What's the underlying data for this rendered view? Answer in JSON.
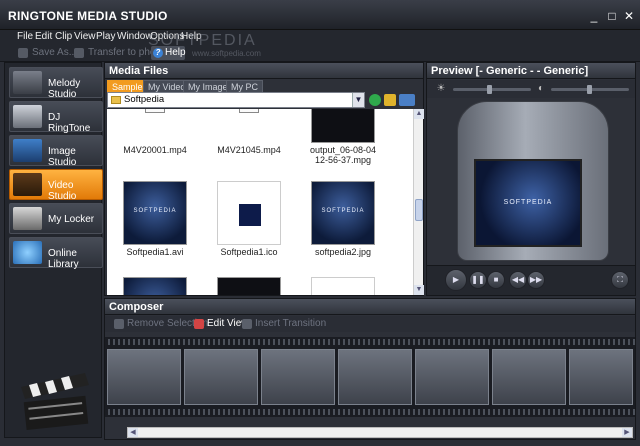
{
  "window": {
    "title": "RINGTONE MEDIA STUDIO",
    "minimize": "_",
    "maximize": "□",
    "close": "✕"
  },
  "menu": [
    "File",
    "Edit",
    "Clip",
    "View",
    "Play",
    "Window",
    "Options",
    "Help"
  ],
  "toolbar": {
    "save_as": "Save As...",
    "transfer": "Transfer to phone",
    "help": "Help",
    "help_glyph": "?"
  },
  "watermark": {
    "main": "SOFTPEDIA",
    "sub": "www.softpedia.com"
  },
  "sidebar": {
    "items": [
      {
        "label": "Melody Studio",
        "active": false
      },
      {
        "label": "DJ RingTone",
        "active": false
      },
      {
        "label": "Image Studio",
        "active": false
      },
      {
        "label": "Video Studio",
        "active": true
      },
      {
        "label": "My Locker",
        "active": false
      },
      {
        "label": "Online Library",
        "active": false
      }
    ]
  },
  "media": {
    "title": "Media Files",
    "tabs": [
      "Samples",
      "My Videos",
      "My Images",
      "My PC"
    ],
    "selected_tab": "Samples",
    "path": "Softpedia",
    "files": [
      {
        "name": "M4V20001.mp4",
        "kind": "doc"
      },
      {
        "name": "M4V21045.mp4",
        "kind": "doc"
      },
      {
        "name": "output_06-08-04 12-56-37.mpg",
        "kind": "dark"
      },
      {
        "name": "Softpedia1.avi",
        "kind": "blue"
      },
      {
        "name": "Softpedia1.ico",
        "kind": "ico"
      },
      {
        "name": "softpedia2.jpg",
        "kind": "blue"
      }
    ],
    "thumb_text": "SOFTPEDIA"
  },
  "preview": {
    "title": "Preview [- Generic - - Generic]",
    "screen_text": "SOFTPEDIA"
  },
  "playback": {
    "play": "▶",
    "pause": "❚❚",
    "stop": "■",
    "prev": "◀◀",
    "next": "▶▶",
    "fullscreen": "⛶",
    "brightness_glyph": "☀",
    "contrast_glyph": "◐"
  },
  "composer": {
    "title": "Composer",
    "remove": "Remove Selection",
    "edit_view": "Edit View",
    "insert_transition": "Insert Transition"
  },
  "scroll_glyphs": {
    "up": "▲",
    "down": "▼",
    "left": "◀",
    "right": "▶"
  },
  "colors": {
    "accent": "#f29b1f",
    "panel": "#2d3038"
  }
}
